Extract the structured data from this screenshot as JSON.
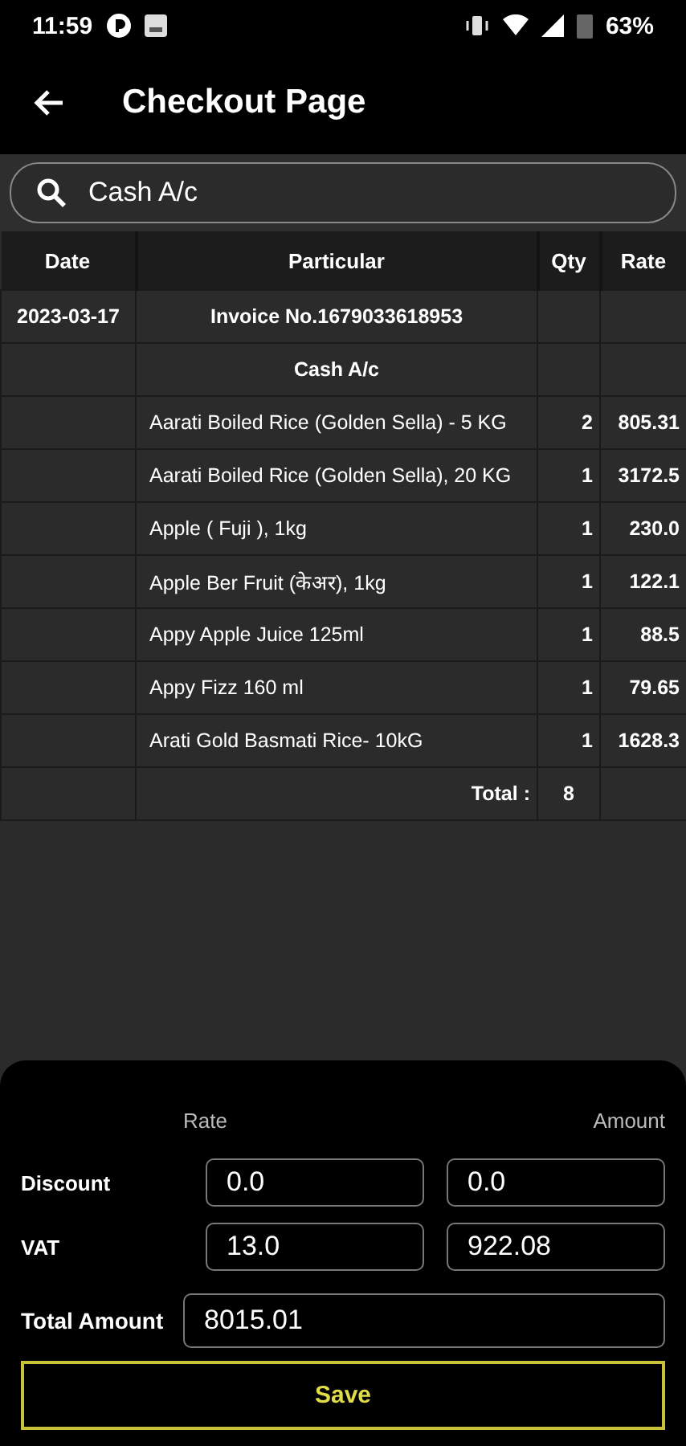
{
  "status_bar": {
    "time": "11:59",
    "battery": "63%"
  },
  "app_bar": {
    "title": "Checkout Page"
  },
  "search": {
    "value": "Cash A/c"
  },
  "table": {
    "columns": [
      "Date",
      "Particular",
      "Qty",
      "Rate"
    ],
    "rows": [
      {
        "kind": "header",
        "date": "2023-03-17",
        "particular": "Invoice No.1679033618953",
        "qty": "",
        "rate": ""
      },
      {
        "kind": "header",
        "date": "",
        "particular": "Cash A/c",
        "qty": "",
        "rate": ""
      },
      {
        "kind": "item",
        "date": "",
        "particular": "Aarati Boiled Rice (Golden Sella) - 5 KG",
        "qty": "2",
        "rate": "805.31"
      },
      {
        "kind": "item",
        "date": "",
        "particular": "Aarati Boiled Rice (Golden Sella), 20 KG",
        "qty": "1",
        "rate": "3172.5"
      },
      {
        "kind": "item",
        "date": "",
        "particular": "Apple ( Fuji ), 1kg",
        "qty": "1",
        "rate": "230.0"
      },
      {
        "kind": "item",
        "date": "",
        "particular": "Apple Ber Fruit (केअर), 1kg",
        "qty": "1",
        "rate": "122.1"
      },
      {
        "kind": "item",
        "date": "",
        "particular": "Appy Apple Juice 125ml",
        "qty": "1",
        "rate": "88.5"
      },
      {
        "kind": "item",
        "date": "",
        "particular": "Appy Fizz 160 ml",
        "qty": "1",
        "rate": "79.65"
      },
      {
        "kind": "item",
        "date": "",
        "particular": "Arati Gold Basmati Rice- 10kG",
        "qty": "1",
        "rate": "1628.3"
      },
      {
        "kind": "total",
        "date": "",
        "particular": "Total :",
        "qty": "8",
        "rate": ""
      }
    ]
  },
  "summary": {
    "rate_label": "Rate",
    "amount_label": "Amount",
    "rows": [
      {
        "label": "Discount",
        "rate": "0.0",
        "amount": "0.0"
      },
      {
        "label": "VAT",
        "rate": "13.0",
        "amount": "922.08"
      }
    ],
    "total_label": "Total Amount",
    "total": "8015.01",
    "save": "Save"
  }
}
